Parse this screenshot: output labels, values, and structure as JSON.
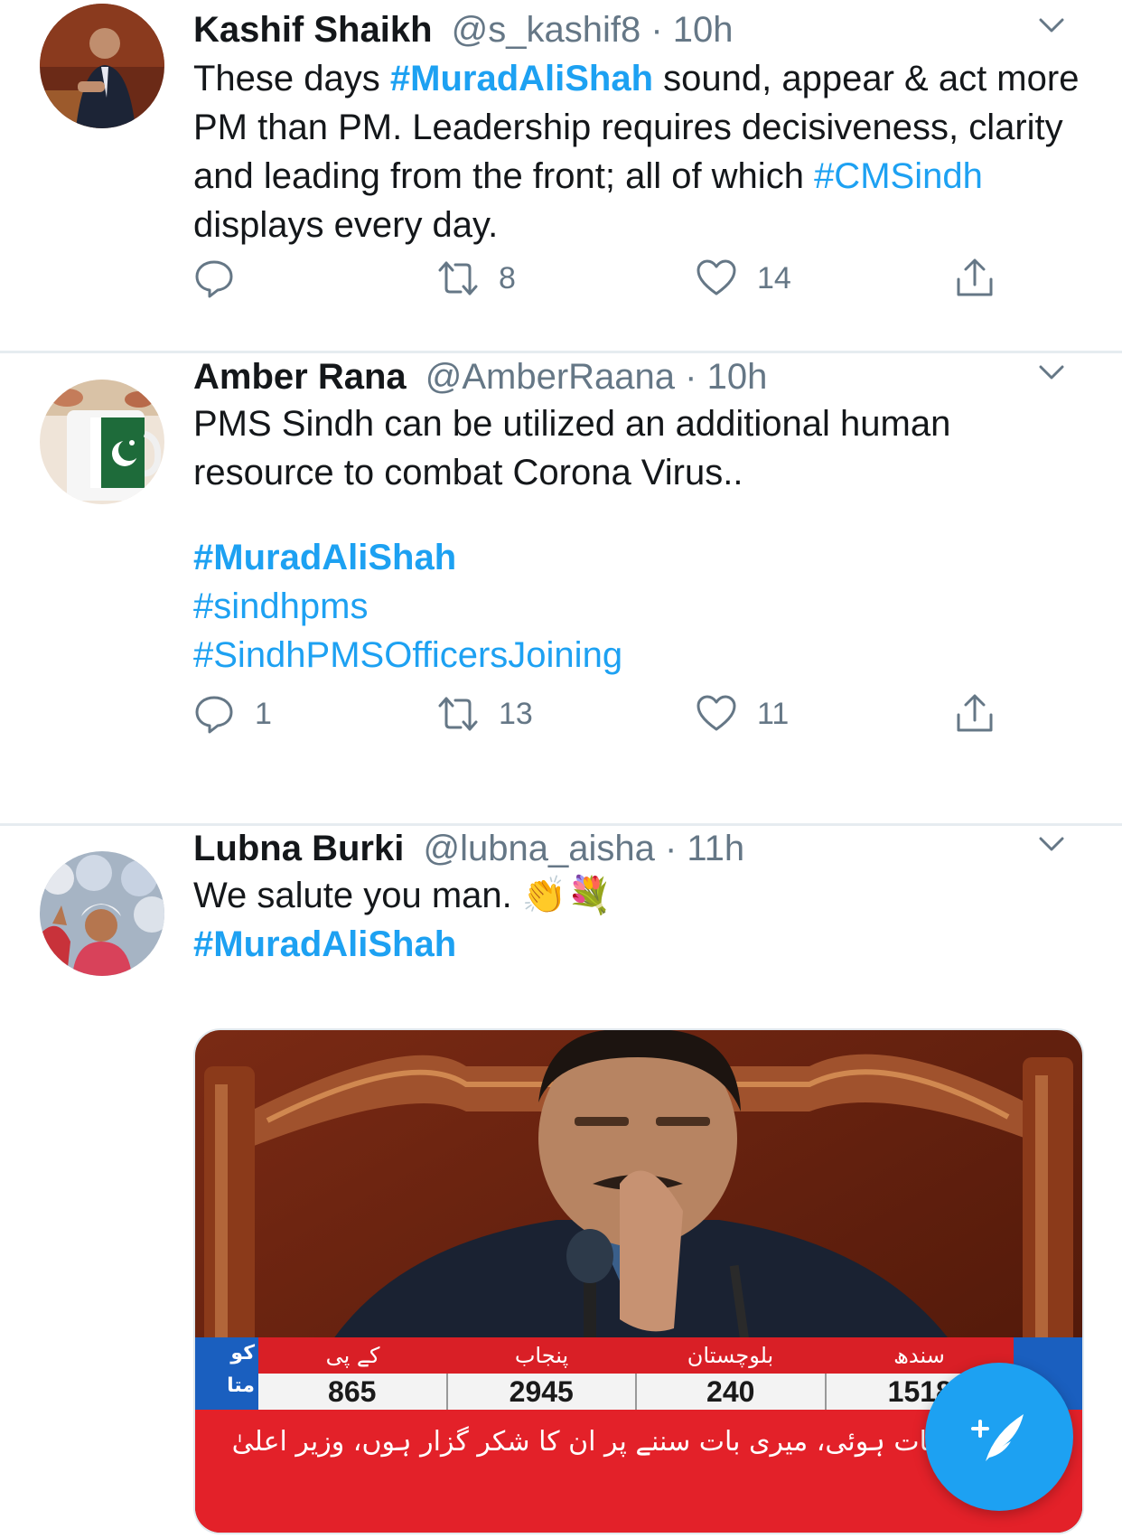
{
  "tweets": [
    {
      "name": "Kashif Shaikh",
      "handle": "@s_kashif8",
      "sep": " · ",
      "time": "10h",
      "text_parts": {
        "p1": "These days ",
        "t1": "#MuradAliShah",
        "p2": " sound, appear & act more PM than PM. Leadership requires decisiveness, clarity and leading from the front; all of which ",
        "t2": "#CMSindh",
        "p3": " displays every day."
      },
      "replies": "",
      "retweets": "8",
      "likes": "14"
    },
    {
      "name": "Amber Rana",
      "handle": "@AmberRaana",
      "sep": " · ",
      "time": "10h",
      "text": "PMS Sindh can be utilized an additional human resource to combat Corona Virus..",
      "hashtags": [
        "#MuradAliShah",
        "#sindhpms",
        "#SindhPMSOfficersJoining"
      ],
      "replies": "1",
      "retweets": "13",
      "likes": "11"
    },
    {
      "name": "Lubna Burki",
      "handle": "@lubna_aisha",
      "sep": " · ",
      "time": "11h",
      "text": "We salute you man. 👏💐",
      "hashtag": "#MuradAliShah",
      "media": {
        "ticker_headers": [
          "کے پی",
          "پنجاب",
          "بلوچستان",
          "سندھ"
        ],
        "ticker_values": [
          "865",
          "2945",
          "240",
          "1518"
        ],
        "ticker_left": "کو\nمتا",
        "ticker_caption": "تاجروں سے بات ہوئی، میری بات سننے پر ان کا شکر گزار ہوں، وزیر اعلیٰ"
      }
    }
  ],
  "colors": {
    "accent": "#1da1f2",
    "muted": "#657786",
    "text": "#14171a",
    "divider": "#e6ecf0"
  },
  "icons": [
    "chevron-down-icon",
    "reply-icon",
    "retweet-icon",
    "like-icon",
    "share-icon",
    "compose-tweet-icon"
  ]
}
